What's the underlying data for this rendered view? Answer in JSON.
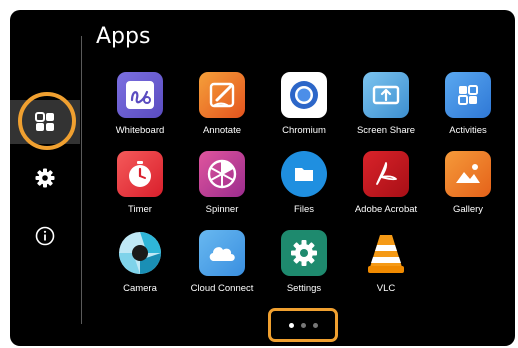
{
  "page": {
    "title": "Apps"
  },
  "sidebar": {
    "items": [
      {
        "icon": "apps-grid-icon",
        "selected": true
      },
      {
        "icon": "gear-icon",
        "selected": false
      },
      {
        "icon": "info-icon",
        "selected": false
      }
    ]
  },
  "apps": [
    {
      "label": "Whiteboard",
      "icon": "whiteboard-icon",
      "color": "#6f5fd0"
    },
    {
      "label": "Annotate",
      "icon": "annotate-icon",
      "color": "#f07d22"
    },
    {
      "label": "Chromium",
      "icon": "chromium-icon",
      "color": "#ffffff"
    },
    {
      "label": "Screen Share",
      "icon": "screen-share-icon",
      "color": "#5aa7dd"
    },
    {
      "label": "Activities",
      "icon": "activities-icon",
      "color": "#3f8fdc"
    },
    {
      "label": "Timer",
      "icon": "timer-icon",
      "color": "#ee3a3a"
    },
    {
      "label": "Spinner",
      "icon": "spinner-icon",
      "color": "#c03a9a"
    },
    {
      "label": "Files",
      "icon": "folder-icon",
      "color": "#1f8fe0"
    },
    {
      "label": "Adobe Acrobat",
      "icon": "acrobat-icon",
      "color": "#c4121a"
    },
    {
      "label": "Gallery",
      "icon": "gallery-icon",
      "color": "#f07a1e"
    },
    {
      "label": "Camera",
      "icon": "camera-icon",
      "color": "#1aa7c9"
    },
    {
      "label": "Cloud Connect",
      "icon": "cloud-icon",
      "color": "#49a6e8"
    },
    {
      "label": "Settings",
      "icon": "settings-app-icon",
      "color": "#1e8a6e"
    },
    {
      "label": "VLC",
      "icon": "vlc-icon",
      "color": "#f08a00"
    }
  ],
  "pagination": {
    "total": 3,
    "current": 1
  },
  "colors": {
    "focus": "#f0a030",
    "background": "#000000"
  }
}
